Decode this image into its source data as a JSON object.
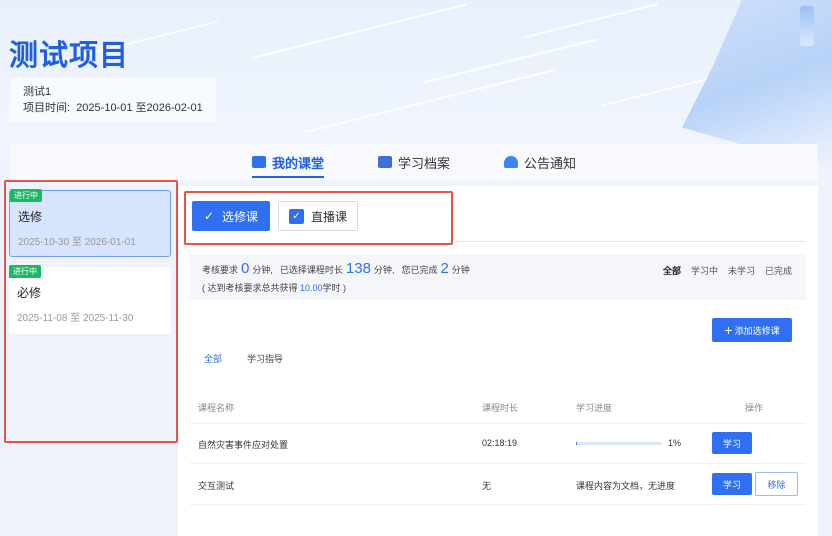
{
  "project": {
    "title": "测试项目",
    "name": "测试1",
    "time_label": "项目时间:",
    "time_range": "2025-10-01 至2026-02-01"
  },
  "tabs": [
    {
      "label": "我的课堂",
      "icon": "classroom-icon",
      "active": true
    },
    {
      "label": "学习档案",
      "icon": "archive-icon",
      "active": false
    },
    {
      "label": "公告通知",
      "icon": "notice-icon",
      "active": false
    }
  ],
  "courses": [
    {
      "badge": "进行中",
      "name": "选修",
      "dates": "2025-10-30 至 2026-01-01",
      "active": true
    },
    {
      "badge": "进行中",
      "name": "必修",
      "dates": "2025-11-08 至 2025-11-30",
      "active": false
    }
  ],
  "course_types": {
    "elective": "选修课",
    "live": "直播课"
  },
  "requirement": {
    "prefix": "考核要求",
    "required_minutes": "0",
    "unit": "分钟,",
    "selected_label": "已选择课程时长",
    "selected_minutes": "138",
    "completed_label": "您已完成",
    "completed_minutes": "2",
    "unit_end": "分钟",
    "note_prefix": "( 达到考核要求总共获得",
    "credit": "10.00",
    "note_suffix": "学时 )"
  },
  "status_filters": [
    "全部",
    "学习中",
    "未学习",
    "已完成"
  ],
  "add_button": "添加选修课",
  "sub_tabs": [
    "全部",
    "学习指导"
  ],
  "table": {
    "headers": [
      "课程名称",
      "课程时长",
      "学习进度",
      "操作"
    ],
    "rows": [
      {
        "name": "自然灾害事件应对处置",
        "duration": "02:18:19",
        "progress_percent": 1,
        "progress_text": "1%",
        "actions": [
          "学习"
        ]
      },
      {
        "name": "交互测试",
        "duration": "无",
        "progress_text": "课程内容为文档，无进度",
        "actions": [
          "学习",
          "移除"
        ]
      }
    ]
  },
  "colors": {
    "accent": "#2f6ff0",
    "badge": "#1db864",
    "highlight_border": "#e8524a"
  }
}
